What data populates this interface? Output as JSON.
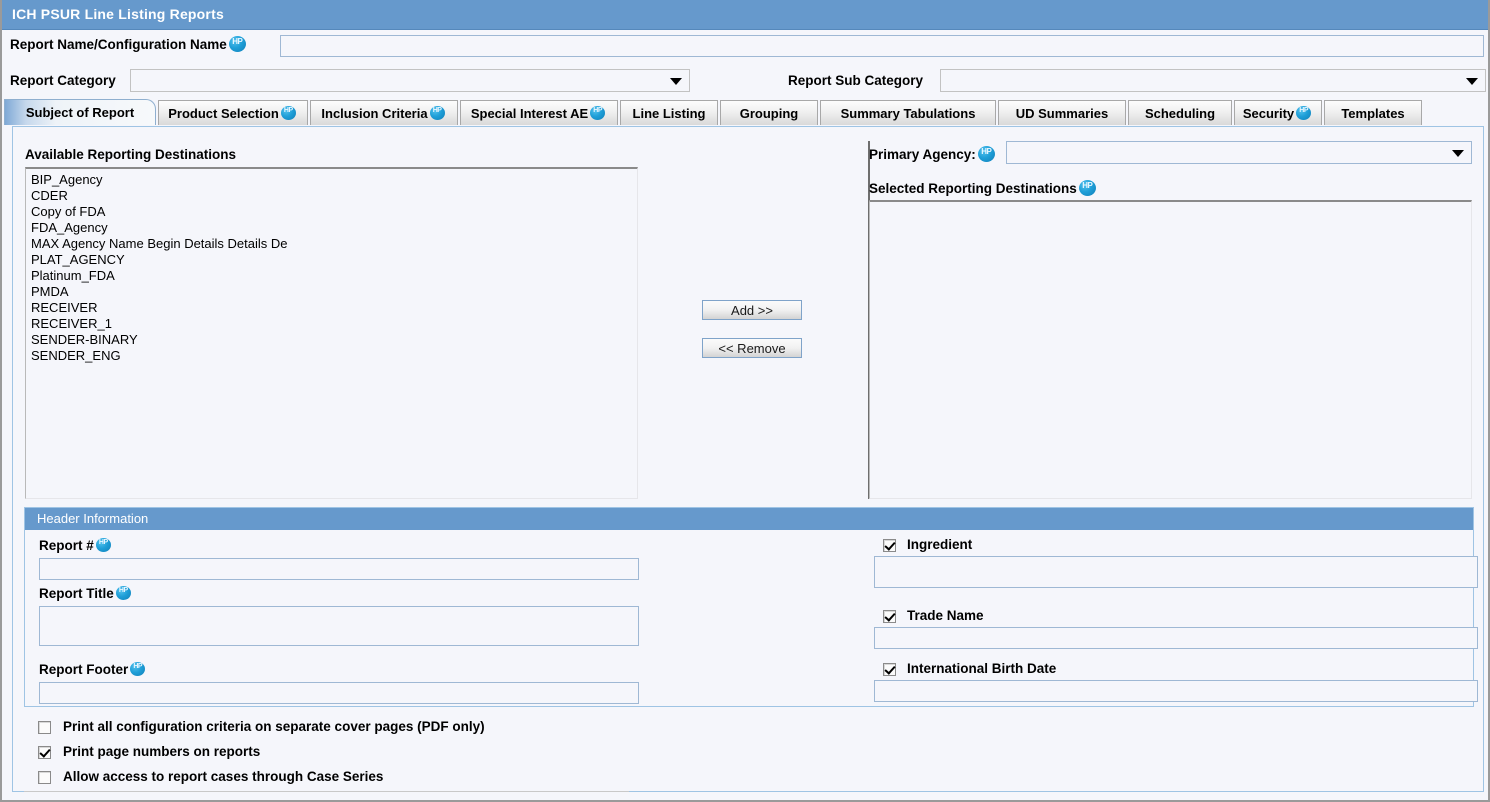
{
  "window": {
    "title": "ICH PSUR Line Listing Reports"
  },
  "topform": {
    "report_name_label": "Report Name/Configuration Name",
    "report_name_value": "",
    "report_category_label": "Report Category",
    "report_category_value": "",
    "report_sub_category_label": "Report Sub Category",
    "report_sub_category_value": ""
  },
  "tabs": [
    {
      "label": "Subject of Report",
      "active": true,
      "help": false
    },
    {
      "label": "Product Selection",
      "active": false,
      "help": true
    },
    {
      "label": "Inclusion Criteria",
      "active": false,
      "help": true
    },
    {
      "label": "Special Interest AE",
      "active": false,
      "help": true
    },
    {
      "label": "Line Listing",
      "active": false,
      "help": false
    },
    {
      "label": "Grouping",
      "active": false,
      "help": false
    },
    {
      "label": "Summary Tabulations",
      "active": false,
      "help": false
    },
    {
      "label": "UD Summaries",
      "active": false,
      "help": false
    },
    {
      "label": "Scheduling",
      "active": false,
      "help": false
    },
    {
      "label": "Security",
      "active": false,
      "help": true
    },
    {
      "label": "Templates",
      "active": false,
      "help": false
    }
  ],
  "subject": {
    "available_label": "Available Reporting Destinations",
    "available_items": [
      "BIP_Agency",
      "CDER",
      "Copy of FDA",
      "FDA_Agency",
      "MAX Agency Name Begin Details Details De",
      "PLAT_AGENCY",
      "Platinum_FDA",
      "PMDA",
      "RECEIVER",
      "RECEIVER_1",
      "SENDER-BINARY",
      "SENDER_ENG"
    ],
    "add_button": "Add >>",
    "remove_button": "<< Remove",
    "primary_agency_label": "Primary Agency:",
    "primary_agency_value": "",
    "selected_label": "Selected Reporting Destinations",
    "selected_items": []
  },
  "header_information": {
    "section_title": "Header Information",
    "report_number_label": "Report #",
    "report_number_value": "",
    "report_title_label": "Report Title",
    "report_title_value": "",
    "report_footer_label": "Report Footer",
    "report_footer_value": "",
    "ingredient_label": "Ingredient",
    "ingredient_checked": true,
    "ingredient_value": "",
    "trade_name_label": "Trade Name",
    "trade_name_checked": true,
    "trade_name_value": "",
    "ibd_label": "International Birth Date",
    "ibd_checked": true,
    "ibd_value": ""
  },
  "options": [
    {
      "label": "Print all configuration criteria on separate cover pages (PDF only)",
      "checked": false
    },
    {
      "label": "Print page numbers on reports",
      "checked": true
    },
    {
      "label": "Allow access to report cases through Case Series",
      "checked": false
    }
  ],
  "colors": {
    "title_bar": "#6699cc",
    "panel_border": "#9fc4e4",
    "background": "#f5f6fb",
    "help_icon": "#1f9fd8"
  }
}
